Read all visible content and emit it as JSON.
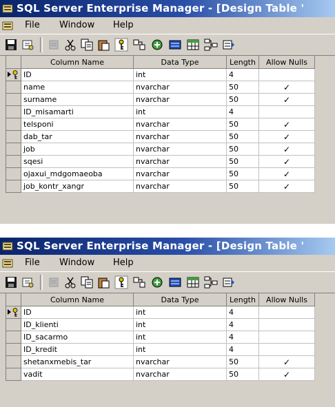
{
  "window1": {
    "title": "SQL Server Enterprise Manager - [Design Table '",
    "menu": [
      "File",
      "Window",
      "Help"
    ],
    "toolbar_icons": [
      "save-icon",
      "properties-icon",
      "cut-disabled-icon",
      "cut-icon",
      "copy-icon",
      "paste-icon",
      "primary-key-icon",
      "manage-relationships-icon",
      "manage-indexes-icon",
      "manage-constraints-icon",
      "table-icon",
      "relationships-icon",
      "triggers-icon"
    ],
    "columns": [
      "Column Name",
      "Data Type",
      "Length",
      "Allow Nulls"
    ],
    "rows": [
      {
        "name": "ID",
        "type": "int",
        "length": "4",
        "nulls": "",
        "key": true
      },
      {
        "name": "name",
        "type": "nvarchar",
        "length": "50",
        "nulls": "✓",
        "key": false
      },
      {
        "name": "surname",
        "type": "nvarchar",
        "length": "50",
        "nulls": "✓",
        "key": false
      },
      {
        "name": "ID_misamarti",
        "type": "int",
        "length": "4",
        "nulls": "",
        "key": false
      },
      {
        "name": "telsponi",
        "type": "nvarchar",
        "length": "50",
        "nulls": "✓",
        "key": false
      },
      {
        "name": "dab_tar",
        "type": "nvarchar",
        "length": "50",
        "nulls": "✓",
        "key": false
      },
      {
        "name": "job",
        "type": "nvarchar",
        "length": "50",
        "nulls": "✓",
        "key": false
      },
      {
        "name": "sqesi",
        "type": "nvarchar",
        "length": "50",
        "nulls": "✓",
        "key": false
      },
      {
        "name": "ojaxui_mdgomaeoba",
        "type": "nvarchar",
        "length": "50",
        "nulls": "✓",
        "key": false
      },
      {
        "name": "job_kontr_xangr",
        "type": "nvarchar",
        "length": "50",
        "nulls": "✓",
        "key": false
      }
    ]
  },
  "window2": {
    "title": "SQL Server Enterprise Manager - [Design Table '",
    "menu": [
      "File",
      "Window",
      "Help"
    ],
    "columns": [
      "Column Name",
      "Data Type",
      "Length",
      "Allow Nulls"
    ],
    "rows": [
      {
        "name": "ID",
        "type": "int",
        "length": "4",
        "nulls": "",
        "key": true
      },
      {
        "name": "ID_klienti",
        "type": "int",
        "length": "4",
        "nulls": "",
        "key": false
      },
      {
        "name": "ID_sacarmo",
        "type": "int",
        "length": "4",
        "nulls": "",
        "key": false
      },
      {
        "name": "ID_kredit",
        "type": "int",
        "length": "4",
        "nulls": "",
        "key": false
      },
      {
        "name": "shetanxmebis_tar",
        "type": "nvarchar",
        "length": "50",
        "nulls": "✓",
        "key": false
      },
      {
        "name": "vadit",
        "type": "nvarchar",
        "length": "50",
        "nulls": "✓",
        "key": false
      }
    ]
  },
  "colors": {
    "title_start": "#0a246a",
    "title_end": "#a6caf0",
    "chrome": "#d4d0c8"
  }
}
